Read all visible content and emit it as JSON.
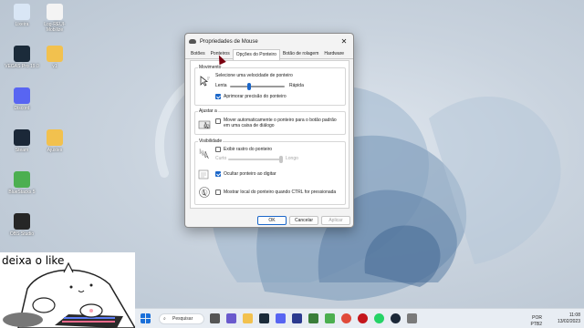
{
  "desktop": {
    "icons": [
      {
        "label": "Lixeira",
        "color": "#d9e6f5"
      },
      {
        "label": "Log-REUI-Mobilize",
        "color": "#f4f4f4"
      },
      {
        "label": "VEGAS Pro 19.0",
        "color": "#1b2b3a"
      },
      {
        "label": "v1",
        "color": "#f2c14e"
      },
      {
        "label": "Discord",
        "color": "#5865f2"
      },
      {
        "label": "Steam",
        "color": "#1b2838"
      },
      {
        "label": "Ajustes",
        "color": "#f2c14e"
      },
      {
        "label": "BlueStacks 5",
        "color": "#4caf50"
      },
      {
        "label": "OBS Studio",
        "color": "#262626"
      }
    ]
  },
  "overlay": {
    "caption": "deixa o like"
  },
  "dialog": {
    "title": "Propriedades de Mouse",
    "close": "✕",
    "tabs": [
      "Botões",
      "Ponteiros",
      "Opções do Ponteiro",
      "Botão de rolagem",
      "Hardware"
    ],
    "active_tab": 2,
    "movement": {
      "legend": "Movimento",
      "prompt": "Selecione uma velocidade de ponteiro",
      "slow": "Lenta",
      "fast": "Rápida",
      "speed_level": 0.35,
      "precision_label": "Aprimorar precisão do ponteiro",
      "precision_checked": true
    },
    "snap": {
      "legend": "Ajustar a",
      "label": "Mover automaticamente o ponteiro para o botão padrão em uma caixa de diálogo",
      "checked": false
    },
    "visibility": {
      "legend": "Visibilidade",
      "trails_label": "Exibir rastro do ponteiro",
      "trails_checked": false,
      "short": "Curto",
      "long": "Longo",
      "hide_label": "Ocultar ponteiro ao digitar",
      "hide_checked": true,
      "ctrl_label": "Mostrar local do ponteiro quando CTRL for pressionada",
      "ctrl_checked": false
    },
    "buttons": {
      "ok": "OK",
      "cancel": "Cancelar",
      "apply": "Aplicar"
    }
  },
  "taskbar": {
    "search_placeholder": "Pesquisar",
    "time": "11:08",
    "date": "13/02/2023",
    "language": "POR PTB2"
  }
}
